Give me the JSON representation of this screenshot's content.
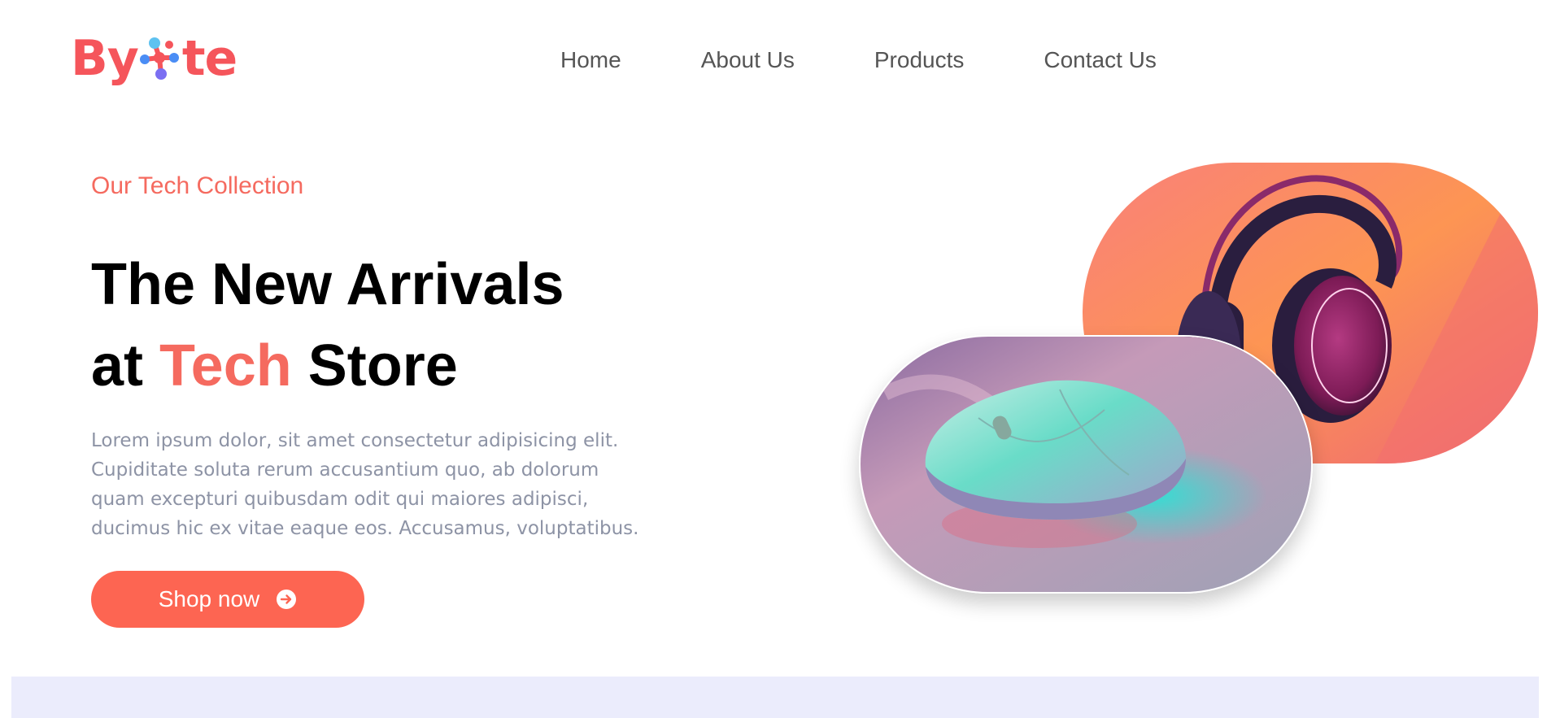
{
  "brand": {
    "logo_left": "By",
    "logo_right": "te",
    "color": "#f5555b"
  },
  "nav": {
    "items": [
      {
        "label": "Home"
      },
      {
        "label": "About Us"
      },
      {
        "label": "Products"
      },
      {
        "label": "Contact Us"
      }
    ]
  },
  "hero": {
    "eyebrow": "Our Tech Collection",
    "headline_line1": "The New Arrivals",
    "headline_prefix": "at",
    "headline_accent": "Tech",
    "headline_suffix": "Store",
    "description": "Lorem ipsum dolor, sit amet consectetur adipisicing elit. Cupiditate soluta rerum accusantium quo, ab dolorum quam excepturi quibusdam odit qui maiores adipisci, ducimus hic ex vitae eaque eos. Accusamus, voluptatibus.",
    "cta_label": "Shop now",
    "cta_icon": "arrow-circle-right-icon",
    "accent_color": "#f56a5f",
    "button_color": "#fd6552"
  },
  "images": {
    "headphones": "headphones-image",
    "mouse": "mouse-image"
  },
  "band_color": "#ebecfc"
}
